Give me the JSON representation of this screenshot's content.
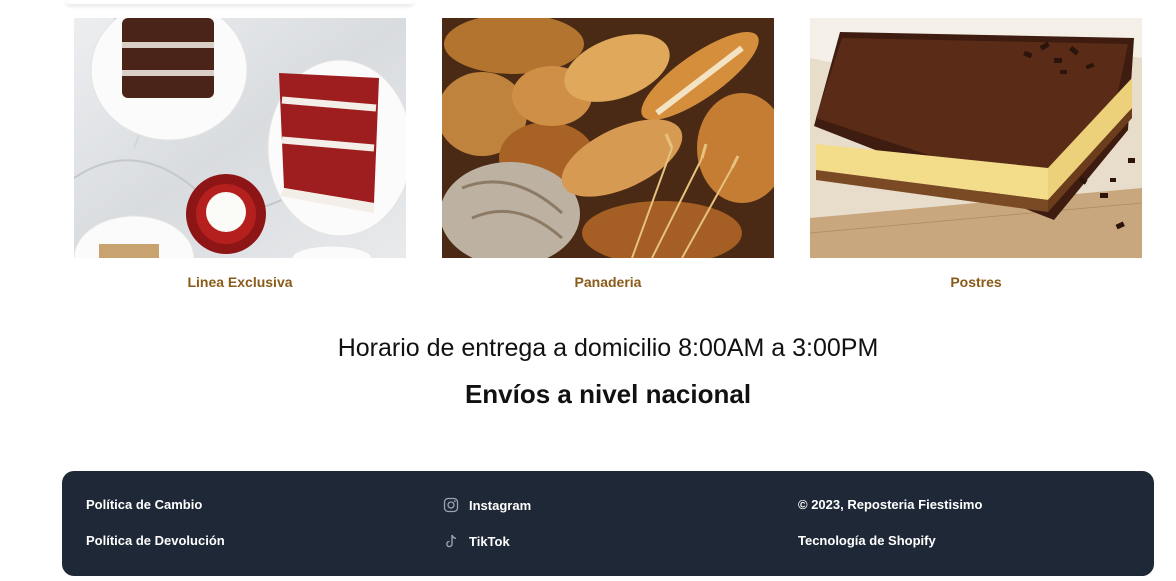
{
  "collections": [
    {
      "label": "Linea Exclusiva",
      "image": "red-velvet-cake-slices"
    },
    {
      "label": "Panaderia",
      "image": "assorted-bread-loaves"
    },
    {
      "label": "Postres",
      "image": "chocolate-custard-dessert"
    }
  ],
  "info": {
    "hours": "Horario de entrega a domicilio 8:00AM a 3:00PM",
    "shipping": "Envíos a nivel nacional"
  },
  "footer": {
    "policies": [
      "Política de Cambio",
      "Política de Devolución"
    ],
    "social": [
      {
        "label": "Instagram",
        "icon": "instagram-icon"
      },
      {
        "label": "TikTok",
        "icon": "tiktok-icon"
      }
    ],
    "copyright": "© 2023, Reposteria Fiestisimo",
    "powered_by": "Tecnología de Shopify",
    "background": "#1f2836"
  },
  "colors": {
    "label_accent": "#8a5a19"
  }
}
